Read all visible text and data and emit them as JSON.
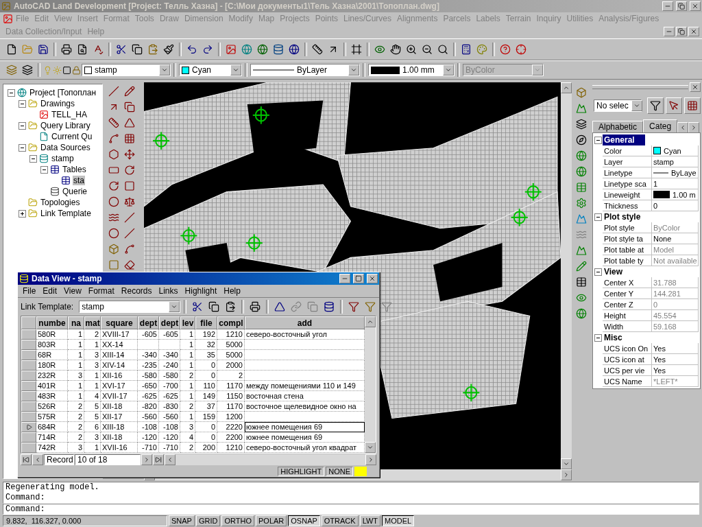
{
  "window": {
    "title": "AutoCAD Land Development [Project: Телль Хазна] - [C:\\Мои документы1\\Тель Хазна\\2001\\Топоплан.dwg]"
  },
  "menu_bar": {
    "items": [
      "File",
      "Edit",
      "View",
      "Insert",
      "Format",
      "Tools",
      "Draw",
      "Dimension",
      "Modify",
      "Map",
      "Projects",
      "Points",
      "Lines/Curves",
      "Alignments",
      "Parcels",
      "Labels",
      "Terrain",
      "Inquiry",
      "Utilities",
      "Analysis/Figures",
      "Data Collection/Input",
      "Help"
    ]
  },
  "properties_toolbar": {
    "layer": "stamp",
    "color_name": "Cyan",
    "linetype": "ByLayer",
    "lineweight": "1.00 mm",
    "plot_style": {
      "label": "ByColor",
      "disabled": true
    }
  },
  "project_tree": [
    {
      "label": "Project [Топоплан",
      "kind": "project",
      "expanded": true,
      "selected": false,
      "children": [
        {
          "label": "Drawings",
          "kind": "folder",
          "expanded": true,
          "selected": false,
          "children": [
            {
              "label": "TELL_HA",
              "kind": "drawing",
              "selected": false
            }
          ]
        },
        {
          "label": "Query Library",
          "kind": "folder",
          "expanded": true,
          "selected": false,
          "children": [
            {
              "label": "Current Qu",
              "kind": "query",
              "selected": false
            }
          ]
        },
        {
          "label": "Data Sources",
          "kind": "folder",
          "expanded": true,
          "selected": false,
          "children": [
            {
              "label": "stamp",
              "kind": "database",
              "expanded": true,
              "selected": false,
              "children": [
                {
                  "label": "Tables",
                  "kind": "tables",
                  "expanded": true,
                  "selected": false,
                  "children": [
                    {
                      "label": "sta",
                      "kind": "table",
                      "selected": true
                    }
                  ]
                },
                {
                  "label": "Querie",
                  "kind": "queries",
                  "selected": false
                }
              ]
            }
          ]
        },
        {
          "label": "Topologies",
          "kind": "folder",
          "selected": false
        },
        {
          "label": "Link Template",
          "kind": "folder",
          "expanded": false,
          "selected": false
        }
      ]
    }
  ],
  "data_view": {
    "title": "Data View - stamp",
    "menu": [
      "File",
      "Edit",
      "View",
      "Format",
      "Records",
      "Links",
      "Highlight",
      "Help"
    ],
    "link_template": {
      "label": "Link Template:",
      "value": "stamp"
    },
    "columns": [
      "numbe",
      "na",
      "mat",
      "square",
      "dept",
      "dept",
      "lev",
      "file",
      "compl",
      "add"
    ],
    "rows": [
      {
        "cells": [
          "580R",
          "1",
          "2",
          "XVIII-17",
          "-605",
          "-605",
          "1",
          "192",
          "1210",
          "северо-восточный угол"
        ],
        "selected": false
      },
      {
        "cells": [
          "803R",
          "1",
          "1",
          "XX-14",
          null,
          null,
          "1",
          "32",
          "5000",
          null
        ],
        "selected": false
      },
      {
        "cells": [
          "68R",
          "1",
          "3",
          "XIII-14",
          "-340",
          "-340",
          "1",
          "35",
          "5000",
          null
        ],
        "selected": false
      },
      {
        "cells": [
          "180R",
          "1",
          "3",
          "XIV-14",
          "-235",
          "-240",
          "1",
          "0",
          "2000",
          null
        ],
        "selected": false
      },
      {
        "cells": [
          "232R",
          "3",
          "1",
          "XII-16",
          "-580",
          "-580",
          "2",
          "0",
          "2",
          null
        ],
        "selected": false
      },
      {
        "cells": [
          "401R",
          "1",
          "1",
          "XVI-17",
          "-650",
          "-700",
          "1",
          "110",
          "1170",
          "между помещениями 110 и 149"
        ],
        "selected": false
      },
      {
        "cells": [
          "483R",
          "1",
          "4",
          "XVII-17",
          "-625",
          "-625",
          "1",
          "149",
          "1150",
          "восточная стена"
        ],
        "selected": false
      },
      {
        "cells": [
          "526R",
          "2",
          "5",
          "XII-18",
          "-820",
          "-830",
          "2",
          "37",
          "1170",
          "восточное щелевидное окно на"
        ],
        "selected": false
      },
      {
        "cells": [
          "575R",
          "2",
          "5",
          "XII-17",
          "-560",
          "-560",
          "1",
          "159",
          "1200",
          null
        ],
        "selected": false
      },
      {
        "cells": [
          "684R",
          "2",
          "6",
          "XIII-18",
          "-108",
          "-108",
          "3",
          "0",
          "2220",
          "южнее помещения 69"
        ],
        "selected": true
      },
      {
        "cells": [
          "714R",
          "2",
          "3",
          "XII-18",
          "-120",
          "-120",
          "4",
          "0",
          "2200",
          "южнее помещения 69"
        ],
        "selected": false
      },
      {
        "cells": [
          "742R",
          "3",
          "1",
          "XVII-16",
          "-710",
          "-710",
          "2",
          "200",
          "1210",
          "северо-восточный угол квадрат"
        ],
        "selected": false
      }
    ],
    "record_label": "Record",
    "record_position": "10 of 18",
    "status": [
      "HIGHLIGHT",
      "NONE"
    ]
  },
  "properties": {
    "selection": "No selec",
    "tabs": [
      {
        "label": "Alphabetic",
        "selected": false
      },
      {
        "label": "Categ",
        "selected": true
      }
    ],
    "sections": [
      {
        "title": "General",
        "expanded": true,
        "rows": [
          {
            "name": "Color",
            "value": "Cyan",
            "kind": "color",
            "disabled": false
          },
          {
            "name": "Layer",
            "value": "stamp",
            "kind": "text",
            "disabled": false
          },
          {
            "name": "Linetype",
            "value": "ByLaye",
            "kind": "linetype",
            "disabled": false
          },
          {
            "name": "Linetype sca",
            "value": "1",
            "kind": "text",
            "disabled": false
          },
          {
            "name": "Lineweight",
            "value": "1.00 m",
            "kind": "lineweight",
            "disabled": false
          },
          {
            "name": "Thickness",
            "value": "0",
            "kind": "text",
            "disabled": false
          }
        ]
      },
      {
        "title": "Plot style",
        "expanded": true,
        "rows": [
          {
            "name": "Plot style",
            "value": "ByColor",
            "kind": "text",
            "disabled": true
          },
          {
            "name": "Plot style ta",
            "value": "None",
            "kind": "text",
            "disabled": false
          },
          {
            "name": "Plot table at",
            "value": "Model",
            "kind": "text",
            "disabled": true
          },
          {
            "name": "Plot table ty",
            "value": "Not available",
            "kind": "text",
            "disabled": true
          }
        ]
      },
      {
        "title": "View",
        "expanded": true,
        "rows": [
          {
            "name": "Center X",
            "value": "31.788",
            "kind": "text",
            "disabled": true
          },
          {
            "name": "Center Y",
            "value": "144.281",
            "kind": "text",
            "disabled": true
          },
          {
            "name": "Center Z",
            "value": "0",
            "kind": "text",
            "disabled": true
          },
          {
            "name": "Height",
            "value": "45.554",
            "kind": "text",
            "disabled": true
          },
          {
            "name": "Width",
            "value": "59.168",
            "kind": "text",
            "disabled": true
          }
        ]
      },
      {
        "title": "Misc",
        "expanded": true,
        "rows": [
          {
            "name": "UCS icon On",
            "value": "Yes",
            "kind": "text",
            "disabled": false
          },
          {
            "name": "UCS icon at",
            "value": "Yes",
            "kind": "text",
            "disabled": false
          },
          {
            "name": "UCS per vie",
            "value": "Yes",
            "kind": "text",
            "disabled": false
          },
          {
            "name": "UCS Name",
            "value": "*LEFT*",
            "kind": "text",
            "disabled": true
          }
        ]
      }
    ]
  },
  "command_line": {
    "history": [
      "Regenerating model.",
      "Command:"
    ],
    "prompt": "Command:"
  },
  "status_bar": {
    "coordinates": "9.832,  116.327, 0.000",
    "toggles": [
      {
        "label": "SNAP",
        "on": false
      },
      {
        "label": "GRID",
        "on": false
      },
      {
        "label": "ORTHO",
        "on": false
      },
      {
        "label": "POLAR",
        "on": false
      },
      {
        "label": "OSNAP",
        "on": true
      },
      {
        "label": "OTRACK",
        "on": false
      },
      {
        "label": "LWT",
        "on": false
      },
      {
        "label": "MODEL",
        "on": true
      }
    ]
  }
}
